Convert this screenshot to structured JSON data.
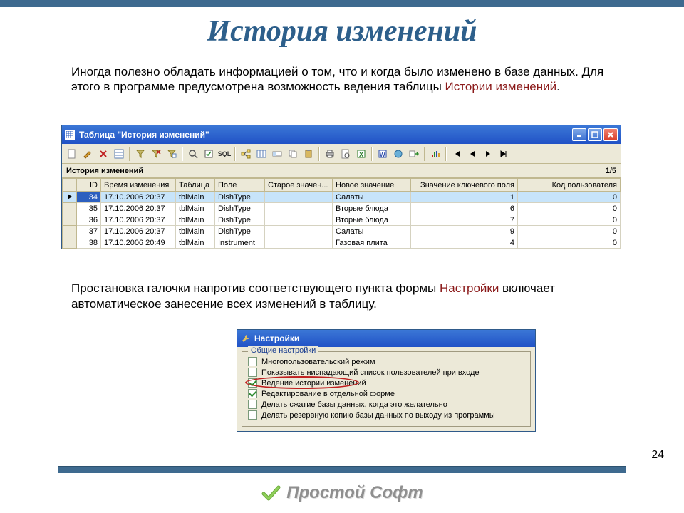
{
  "page": {
    "title": "История изменений",
    "number": "24"
  },
  "intro": {
    "part1": "Иногда полезно обладать информацией о том, что и когда было изменено в базе данных. Для этого в программе предусмотрена возможность ведения таблицы ",
    "red": "Истории изменений",
    "part2": "."
  },
  "window1": {
    "title": "Таблица \"История изменений\"",
    "subheader": "История изменений",
    "counter": "1/5",
    "columns": [
      "ID",
      "Время изменения",
      "Таблица",
      "Поле",
      "Старое значен...",
      "Новое значение",
      "Значение ключевого поля",
      "Код пользователя"
    ],
    "rows": [
      {
        "sel": true,
        "id": "34",
        "time": "17.10.2006 20:37",
        "table": "tblMain",
        "field": "DishType",
        "old": "",
        "new": "Салаты",
        "key": "1",
        "user": "0"
      },
      {
        "sel": false,
        "id": "35",
        "time": "17.10.2006 20:37",
        "table": "tblMain",
        "field": "DishType",
        "old": "",
        "new": "Вторые блюда",
        "key": "6",
        "user": "0"
      },
      {
        "sel": false,
        "id": "36",
        "time": "17.10.2006 20:37",
        "table": "tblMain",
        "field": "DishType",
        "old": "",
        "new": "Вторые блюда",
        "key": "7",
        "user": "0"
      },
      {
        "sel": false,
        "id": "37",
        "time": "17.10.2006 20:37",
        "table": "tblMain",
        "field": "DishType",
        "old": "",
        "new": "Салаты",
        "key": "9",
        "user": "0"
      },
      {
        "sel": false,
        "id": "38",
        "time": "17.10.2006 20:49",
        "table": "tblMain",
        "field": "Instrument",
        "old": "",
        "new": "Газовая плита",
        "key": "4",
        "user": "0"
      }
    ]
  },
  "para2": {
    "part1": "Простановка галочки напротив соответствующего пункта формы ",
    "red": "Настройки",
    "part2": " включает автоматическое занесение всех изменений в таблицу."
  },
  "window2": {
    "title": "Настройки",
    "fieldset_title": "Общие настройки",
    "items": [
      {
        "checked": false,
        "label": "Многопользовательский режим"
      },
      {
        "checked": false,
        "label": "Показывать ниспадающий список пользователей при входе"
      },
      {
        "checked": true,
        "label": "Ведение истории изменений",
        "circled": true
      },
      {
        "checked": true,
        "label": "Редактирование в отдельной форме"
      },
      {
        "checked": false,
        "label": "Делать сжатие базы данных, когда это желательно"
      },
      {
        "checked": false,
        "label": "Делать резервную копию базы данных по выходу из программы"
      }
    ]
  },
  "footer": {
    "brand": "Простой Софт"
  }
}
